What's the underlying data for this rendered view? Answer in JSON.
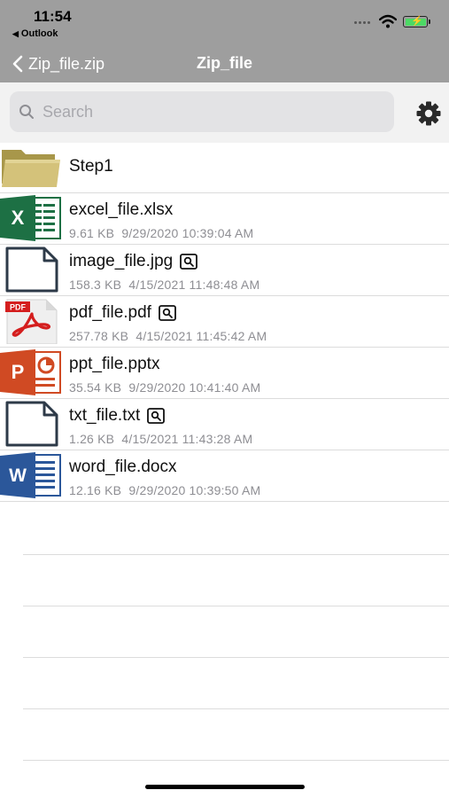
{
  "status_bar": {
    "time": "11:54",
    "back_app": "Outlook",
    "battery_color": "#4cd964"
  },
  "nav": {
    "back_label": "Zip_file.zip",
    "title": "Zip_file"
  },
  "search": {
    "placeholder": "Search",
    "value": ""
  },
  "colors": {
    "header_bg": "#9e9e9e",
    "search_bg": "#e3e3e5",
    "excel": "#1d7044",
    "word": "#2b579a",
    "powerpoint": "#d04a23",
    "pdf": "#d41e1e",
    "folder": "#c9b764"
  },
  "files": [
    {
      "name": "Step1",
      "type": "folder",
      "icon": "folder-icon"
    },
    {
      "name": "excel_file.xlsx",
      "type": "excel",
      "icon": "excel-icon",
      "size": "9.61 KB",
      "date": "9/29/2020 10:39:04 AM",
      "preview": false
    },
    {
      "name": "image_file.jpg",
      "type": "generic",
      "icon": "document-icon",
      "size": "158.3 KB",
      "date": "4/15/2021 11:48:48 AM",
      "preview": true
    },
    {
      "name": "pdf_file.pdf",
      "type": "pdf",
      "icon": "pdf-icon",
      "size": "257.78 KB",
      "date": "4/15/2021 11:45:42 AM",
      "preview": true
    },
    {
      "name": "ppt_file.pptx",
      "type": "powerpoint",
      "icon": "powerpoint-icon",
      "size": "35.54 KB",
      "date": "9/29/2020 10:41:40 AM",
      "preview": false
    },
    {
      "name": "txt_file.txt",
      "type": "generic",
      "icon": "document-icon",
      "size": "1.26 KB",
      "date": "4/15/2021 11:43:28 AM",
      "preview": true
    },
    {
      "name": "word_file.docx",
      "type": "word",
      "icon": "word-icon",
      "size": "12.16 KB",
      "date": "9/29/2020 10:39:50 AM",
      "preview": false
    }
  ]
}
